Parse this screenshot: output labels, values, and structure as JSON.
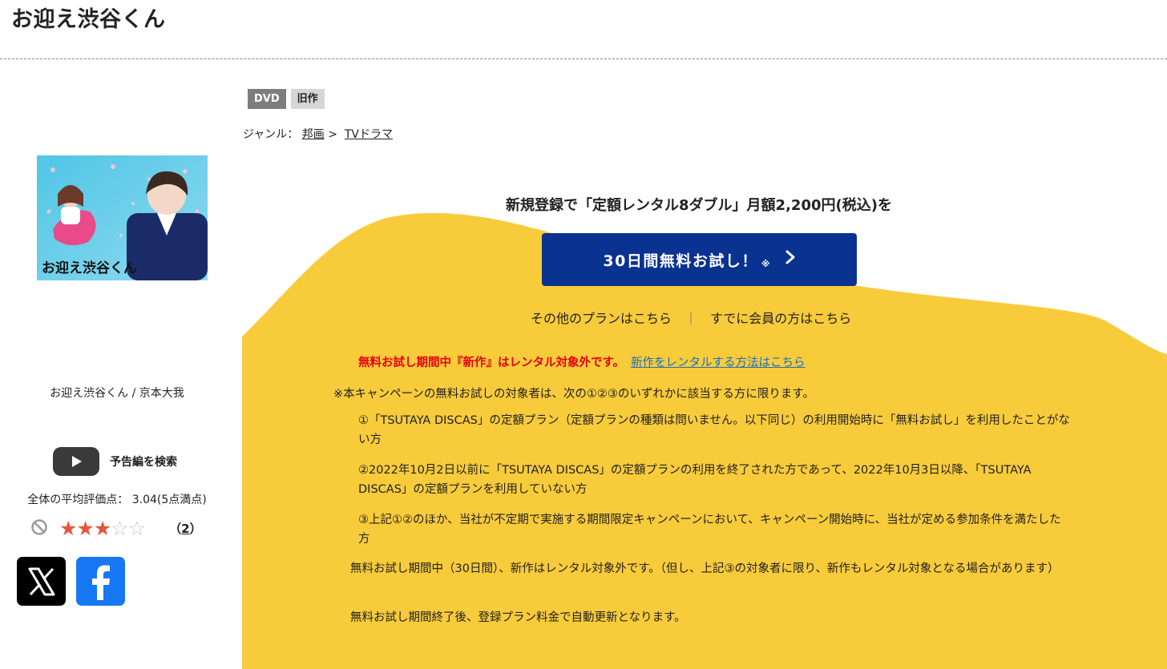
{
  "page": {
    "title": "お迎え渋谷くん"
  },
  "sidebar": {
    "poster_title_text": "お迎え渋谷くん",
    "work_title": "お迎え渋谷くん / 京本大我",
    "trailer_label": "予告編を検索",
    "average_rating_text": "全体の平均評価点： 3.04(5点満点)",
    "rating": {
      "value": 3.04,
      "max": 5,
      "filled_stars": 3,
      "count_text": "2"
    },
    "social": {
      "x_icon": "x-logo-icon",
      "facebook_icon": "facebook-logo-icon"
    }
  },
  "product": {
    "badges": [
      "DVD",
      "旧作"
    ],
    "genre": {
      "label": "ジャンル：",
      "category": "邦画",
      "separator": ">",
      "subcategory": "TVドラマ"
    }
  },
  "promo": {
    "headline": "新規登録で「定額レンタル8ダブル」月額2,200円(税込)を",
    "cta_label": "30日間無料お試し！",
    "cta_note": "※",
    "other_plans": "その他のプランはこちら",
    "separator": "｜",
    "member_link": "すでに会員の方はこちら",
    "notice_red": "無料お試し期間中『新作』はレンタル対象外です。",
    "notice_link": "新作をレンタルする方法はこちら",
    "terms_head": "※本キャンペーンの無料お試しの対象者は、次の①②③のいずれかに該当する方に限ります。",
    "terms": [
      "①「TSUTAYA DISCAS」の定額プラン（定額プランの種類は問いません。以下同じ）の利用開始時に「無料お試し」を利用したことがない方",
      "②2022年10月2日以前に「TSUTAYA DISCAS」の定額プランの利用を終了された方であって、2022年10月3日以降、「TSUTAYA DISCAS」の定額プランを利用していない方",
      "③上記①②のほか、当社が不定期で実施する期間限定キャンペーンにおいて、キャンペーン開始時に、当社が定める参加条件を満たした方"
    ],
    "footnotes": [
      "無料お試し期間中（30日間）、新作はレンタル対象外です。（但し、上記③の対象者に限り、新作もレンタル対象となる場合があります）",
      "無料お試し期間終了後、登録プラン料金で自動更新となります。"
    ]
  },
  "colors": {
    "accent_yellow": "#f8cb3b",
    "cta_blue": "#0a3290",
    "notice_red": "#e60012",
    "link_blue": "#1a6ec4",
    "star": "#e8543a"
  }
}
